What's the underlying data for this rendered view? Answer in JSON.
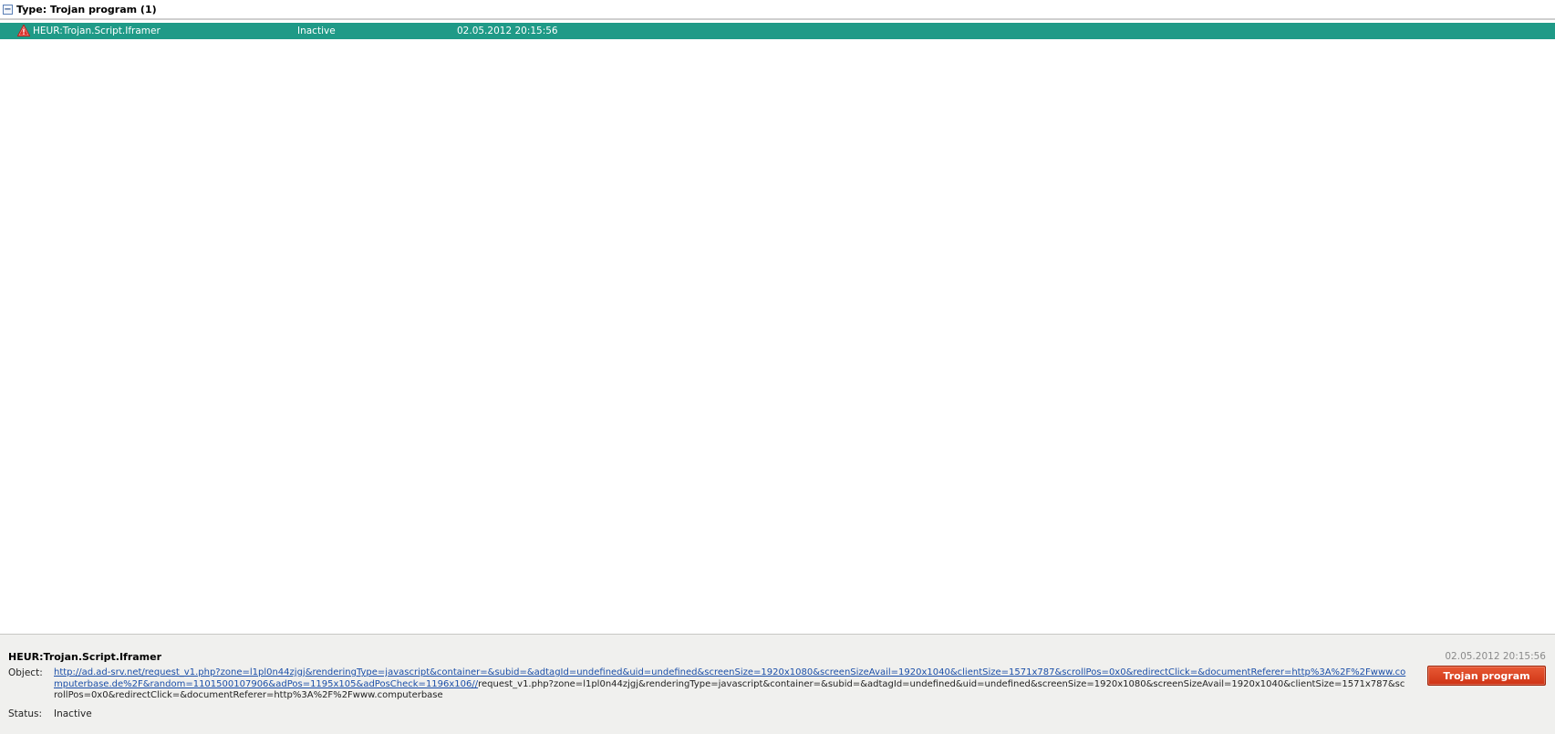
{
  "group": {
    "toggle_glyph": "−",
    "title": "Type: Trojan program (1)"
  },
  "threat_row": {
    "name": "HEUR:Trojan.Script.Iframer",
    "status": "Inactive",
    "date": "02.05.2012 20:15:56",
    "icon": "warning-triangle-icon",
    "highlight_color": "#1f9a87"
  },
  "details": {
    "title": "HEUR:Trojan.Script.Iframer",
    "date": "02.05.2012 20:15:56",
    "object_label": "Object:",
    "object_link": "http://ad.ad-srv.net/request_v1.php?zone=l1pl0n44zjgj&renderingType=javascript&container=&subid=&adtagId=undefined&uid=undefined&screenSize=1920x1080&screenSizeAvail=1920x1040&clientSize=1571x787&scrollPos=0x0&redirectClick=&documentReferer=http%3A%2F%2Fwww.computerbase.de%2F&random=1101500107906&adPos=1195x105&adPosCheck=1196x106//",
    "object_rest": "request_v1.php?zone=l1pl0n44zjgj&renderingType=javascript&container=&subid=&adtagId=undefined&uid=undefined&screenSize=1920x1080&screenSizeAvail=1920x1040&clientSize=1571x787&scrollPos=0x0&redirectClick=&documentReferer=http%3A%2F%2Fwww.computerbase",
    "status_label": "Status:",
    "status_value": "Inactive",
    "type_button": "Trojan program",
    "type_button_color": "#d9401f"
  }
}
